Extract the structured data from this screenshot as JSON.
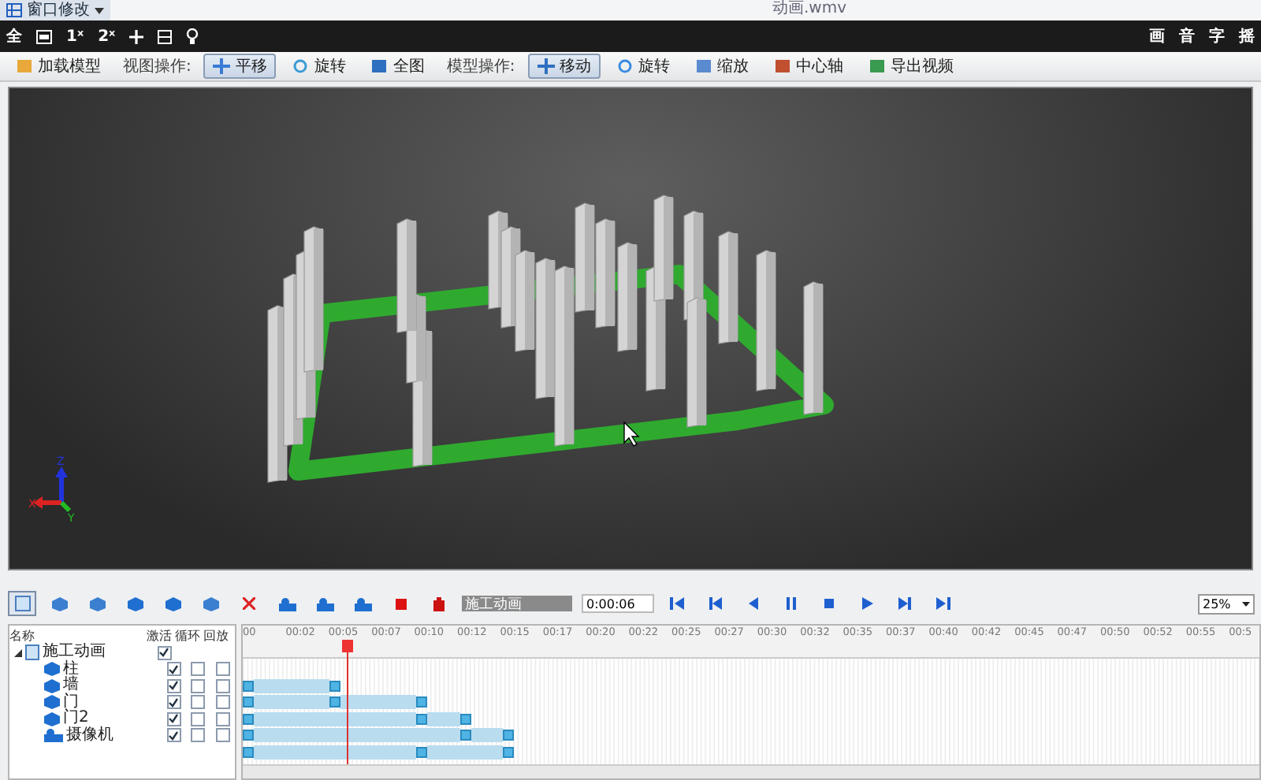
{
  "title_bar": {
    "menu": "窗口修改",
    "title": "动画.wmv"
  },
  "quick_bar": {
    "left": [
      {
        "kind": "text",
        "label": "全"
      },
      {
        "kind": "screen"
      },
      {
        "kind": "text",
        "label": "1ˣ"
      },
      {
        "kind": "text",
        "label": "2ˣ"
      },
      {
        "kind": "plus"
      },
      {
        "kind": "panel"
      },
      {
        "kind": "bulb"
      }
    ],
    "right": [
      "画",
      "音",
      "字",
      "摇"
    ]
  },
  "toolbar": [
    {
      "kind": "button",
      "label": "加载模型",
      "selected": false
    },
    {
      "kind": "label",
      "label": "视图操作:"
    },
    {
      "kind": "button",
      "label": "平移",
      "selected": true
    },
    {
      "kind": "button",
      "label": "旋转",
      "selected": false
    },
    {
      "kind": "button",
      "label": "全图",
      "selected": false
    },
    {
      "kind": "label",
      "label": "模型操作:"
    },
    {
      "kind": "button",
      "label": "移动",
      "selected": true
    },
    {
      "kind": "button",
      "label": "旋转",
      "selected": false
    },
    {
      "kind": "button",
      "label": "缩放",
      "selected": false
    },
    {
      "kind": "button",
      "label": "中心轴",
      "selected": false
    },
    {
      "kind": "button",
      "label": "导出视频",
      "selected": false
    }
  ],
  "viewport": {
    "axis_labels": [
      "X",
      "Y",
      "Z"
    ]
  },
  "animation": {
    "name": "施工动画",
    "time": "0:00:06",
    "zoom": "25%",
    "playhead": {
      "level": 0.103
    }
  },
  "tree": {
    "columns": [
      "名称",
      "激活",
      "循环",
      "回放"
    ],
    "items": [
      {
        "label": "施工动画",
        "kind": "animation",
        "expanded": true,
        "active": true,
        "children": [
          {
            "label": "柱",
            "kind": "object",
            "active": true,
            "loop": false,
            "replay": false,
            "keys": [
              {
                "level": 0
              },
              {
                "level": 0.086
              }
            ]
          },
          {
            "label": "墙",
            "kind": "object",
            "active": true,
            "loop": false,
            "replay": false,
            "keys": [
              {
                "level": 0
              },
              {
                "level": 0.086
              },
              {
                "level": 0.173
              }
            ]
          },
          {
            "label": "门",
            "kind": "object",
            "active": true,
            "loop": false,
            "replay": false,
            "keys": [
              {
                "level": 0
              },
              {
                "level": 0.173
              },
              {
                "level": 0.216
              }
            ]
          },
          {
            "label": "门2",
            "kind": "object",
            "active": true,
            "loop": false,
            "replay": false,
            "keys": [
              {
                "level": 0
              },
              {
                "level": 0.216
              },
              {
                "level": 0.259
              }
            ]
          },
          {
            "label": "摄像机",
            "kind": "camera",
            "active": true,
            "loop": false,
            "replay": false,
            "keys": [
              {
                "level": 0
              },
              {
                "level": 0.173
              },
              {
                "level": 0.259
              }
            ]
          }
        ]
      }
    ]
  },
  "ruler": [
    "00",
    "00:02",
    "00:05",
    "00:07",
    "00:10",
    "00:12",
    "00:15",
    "00:17",
    "00:20",
    "00:22",
    "00:25",
    "00:27",
    "00:30",
    "00:32",
    "00:35",
    "00:37",
    "00:40",
    "00:42",
    "00:45",
    "00:47",
    "00:50",
    "00:52",
    "00:55",
    "00:5"
  ]
}
